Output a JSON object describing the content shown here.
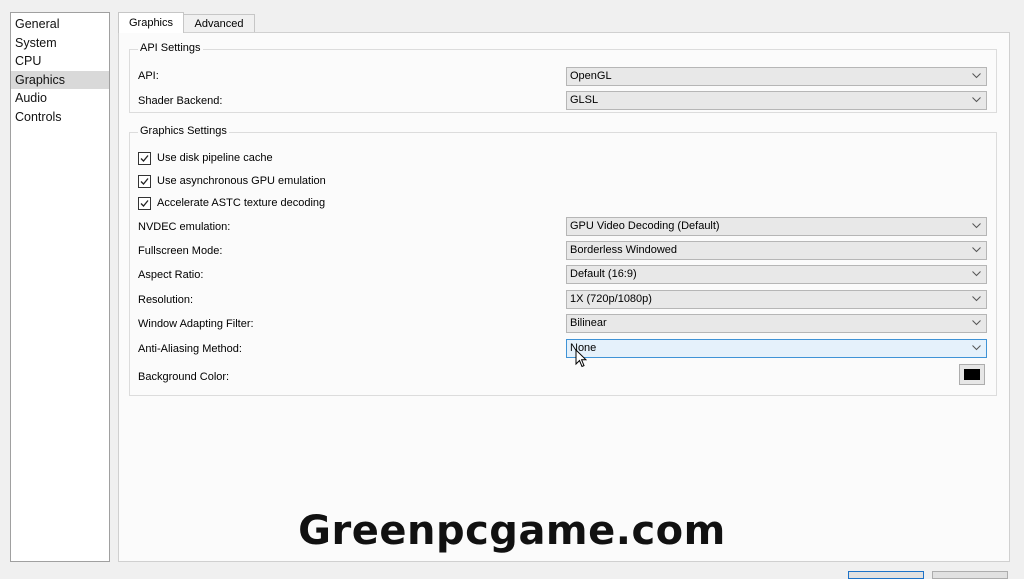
{
  "sidebar": {
    "items": [
      {
        "label": "General"
      },
      {
        "label": "System"
      },
      {
        "label": "CPU"
      },
      {
        "label": "Graphics",
        "selected": true
      },
      {
        "label": "Audio"
      },
      {
        "label": "Controls"
      }
    ]
  },
  "tabs": [
    {
      "label": "Graphics",
      "active": true
    },
    {
      "label": "Advanced",
      "active": false
    }
  ],
  "api_settings": {
    "title": "API Settings",
    "api": {
      "label": "API:",
      "value": "OpenGL"
    },
    "shader_backend": {
      "label": "Shader Backend:",
      "value": "GLSL"
    }
  },
  "graphics_settings": {
    "title": "Graphics Settings",
    "checkboxes": [
      {
        "label": "Use disk pipeline cache",
        "checked": true
      },
      {
        "label": "Use asynchronous GPU emulation",
        "checked": true
      },
      {
        "label": "Accelerate ASTC texture decoding",
        "checked": true
      }
    ],
    "nvdec": {
      "label": "NVDEC emulation:",
      "value": "GPU Video Decoding (Default)"
    },
    "fullscreen_mode": {
      "label": "Fullscreen Mode:",
      "value": "Borderless Windowed"
    },
    "aspect_ratio": {
      "label": "Aspect Ratio:",
      "value": "Default (16:9)"
    },
    "resolution": {
      "label": "Resolution:",
      "value": "1X (720p/1080p)"
    },
    "window_filter": {
      "label": "Window Adapting Filter:",
      "value": "Bilinear"
    },
    "anti_aliasing": {
      "label": "Anti-Aliasing Method:",
      "value": "None"
    },
    "background_color": {
      "label": "Background Color:",
      "value": "#000000"
    }
  },
  "watermark": {
    "text": "Greenpcgame.com"
  },
  "icons": {
    "dropdown": "chevron-down-icon",
    "checkbox": "checkmark-icon",
    "cursor": "mouse-cursor-icon"
  },
  "colors": {
    "accent": "#3f93d6",
    "background_swatch": "#000000"
  }
}
